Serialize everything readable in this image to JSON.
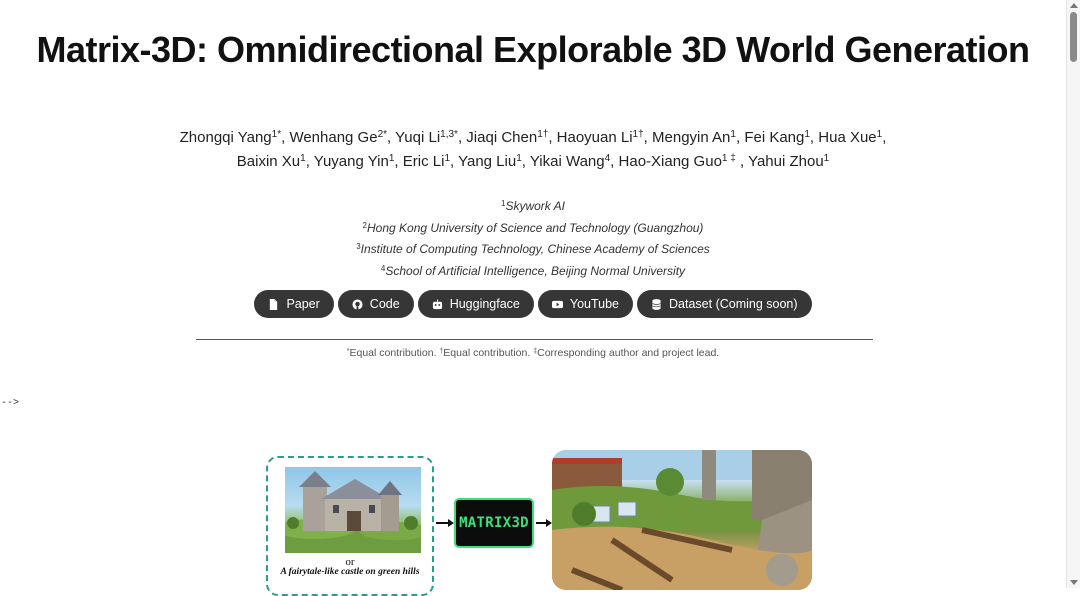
{
  "header": {
    "title": "Matrix-3D: Omnidirectional Explorable 3D World Generation"
  },
  "authors": [
    {
      "name": "Zhongqi Yang",
      "sup": "1*"
    },
    {
      "name": "Wenhang Ge",
      "sup": "2*"
    },
    {
      "name": "Yuqi Li",
      "sup": "1,3*"
    },
    {
      "name": "Jiaqi Chen",
      "sup": "1†"
    },
    {
      "name": "Haoyuan Li",
      "sup": "1†"
    },
    {
      "name": "Mengyin An",
      "sup": "1"
    },
    {
      "name": "Fei Kang",
      "sup": "1"
    },
    {
      "name": "Hua Xue",
      "sup": "1"
    },
    {
      "name": "Baixin Xu",
      "sup": "1"
    },
    {
      "name": "Yuyang Yin",
      "sup": "1"
    },
    {
      "name": "Eric Li",
      "sup": "1"
    },
    {
      "name": "Yang Liu",
      "sup": "1"
    },
    {
      "name": "Yikai Wang",
      "sup": "4"
    },
    {
      "name": "Hao-Xiang Guo",
      "sup": "1 ‡"
    },
    {
      "name": "Yahui Zhou",
      "sup": "1"
    }
  ],
  "affiliations": [
    {
      "sup": "1",
      "name": "Skywork AI"
    },
    {
      "sup": "2",
      "name": "Hong Kong University of Science and Technology (Guangzhou)"
    },
    {
      "sup": "3",
      "name": "Institute of Computing Technology, Chinese Academy of Sciences"
    },
    {
      "sup": "4",
      "name": "School of Artificial Intelligence, Beijing Normal University"
    }
  ],
  "links": [
    {
      "label": "Paper",
      "icon": "file-pdf-icon"
    },
    {
      "label": "Code",
      "icon": "github-icon"
    },
    {
      "label": "Huggingface",
      "icon": "robot-icon"
    },
    {
      "label": "YouTube",
      "icon": "youtube-icon"
    },
    {
      "label": "Dataset (Coming soon)",
      "icon": "database-icon"
    }
  ],
  "footnote": {
    "equal1_mark": "*",
    "equal1_text": "Equal contribution.",
    "equal2_mark": "†",
    "equal2_text": "Equal contribution.",
    "corr_mark": "‡",
    "corr_text": "Corresponding author and project lead."
  },
  "stray_text": "-->",
  "figure": {
    "or_text": "or",
    "input_caption": "A fairytale-like castle on green hills",
    "model_label": "MATRIX3D"
  },
  "colors": {
    "button_bg": "#363636",
    "teal_dashed": "#2a9d8f",
    "model_green": "#3be07d"
  }
}
